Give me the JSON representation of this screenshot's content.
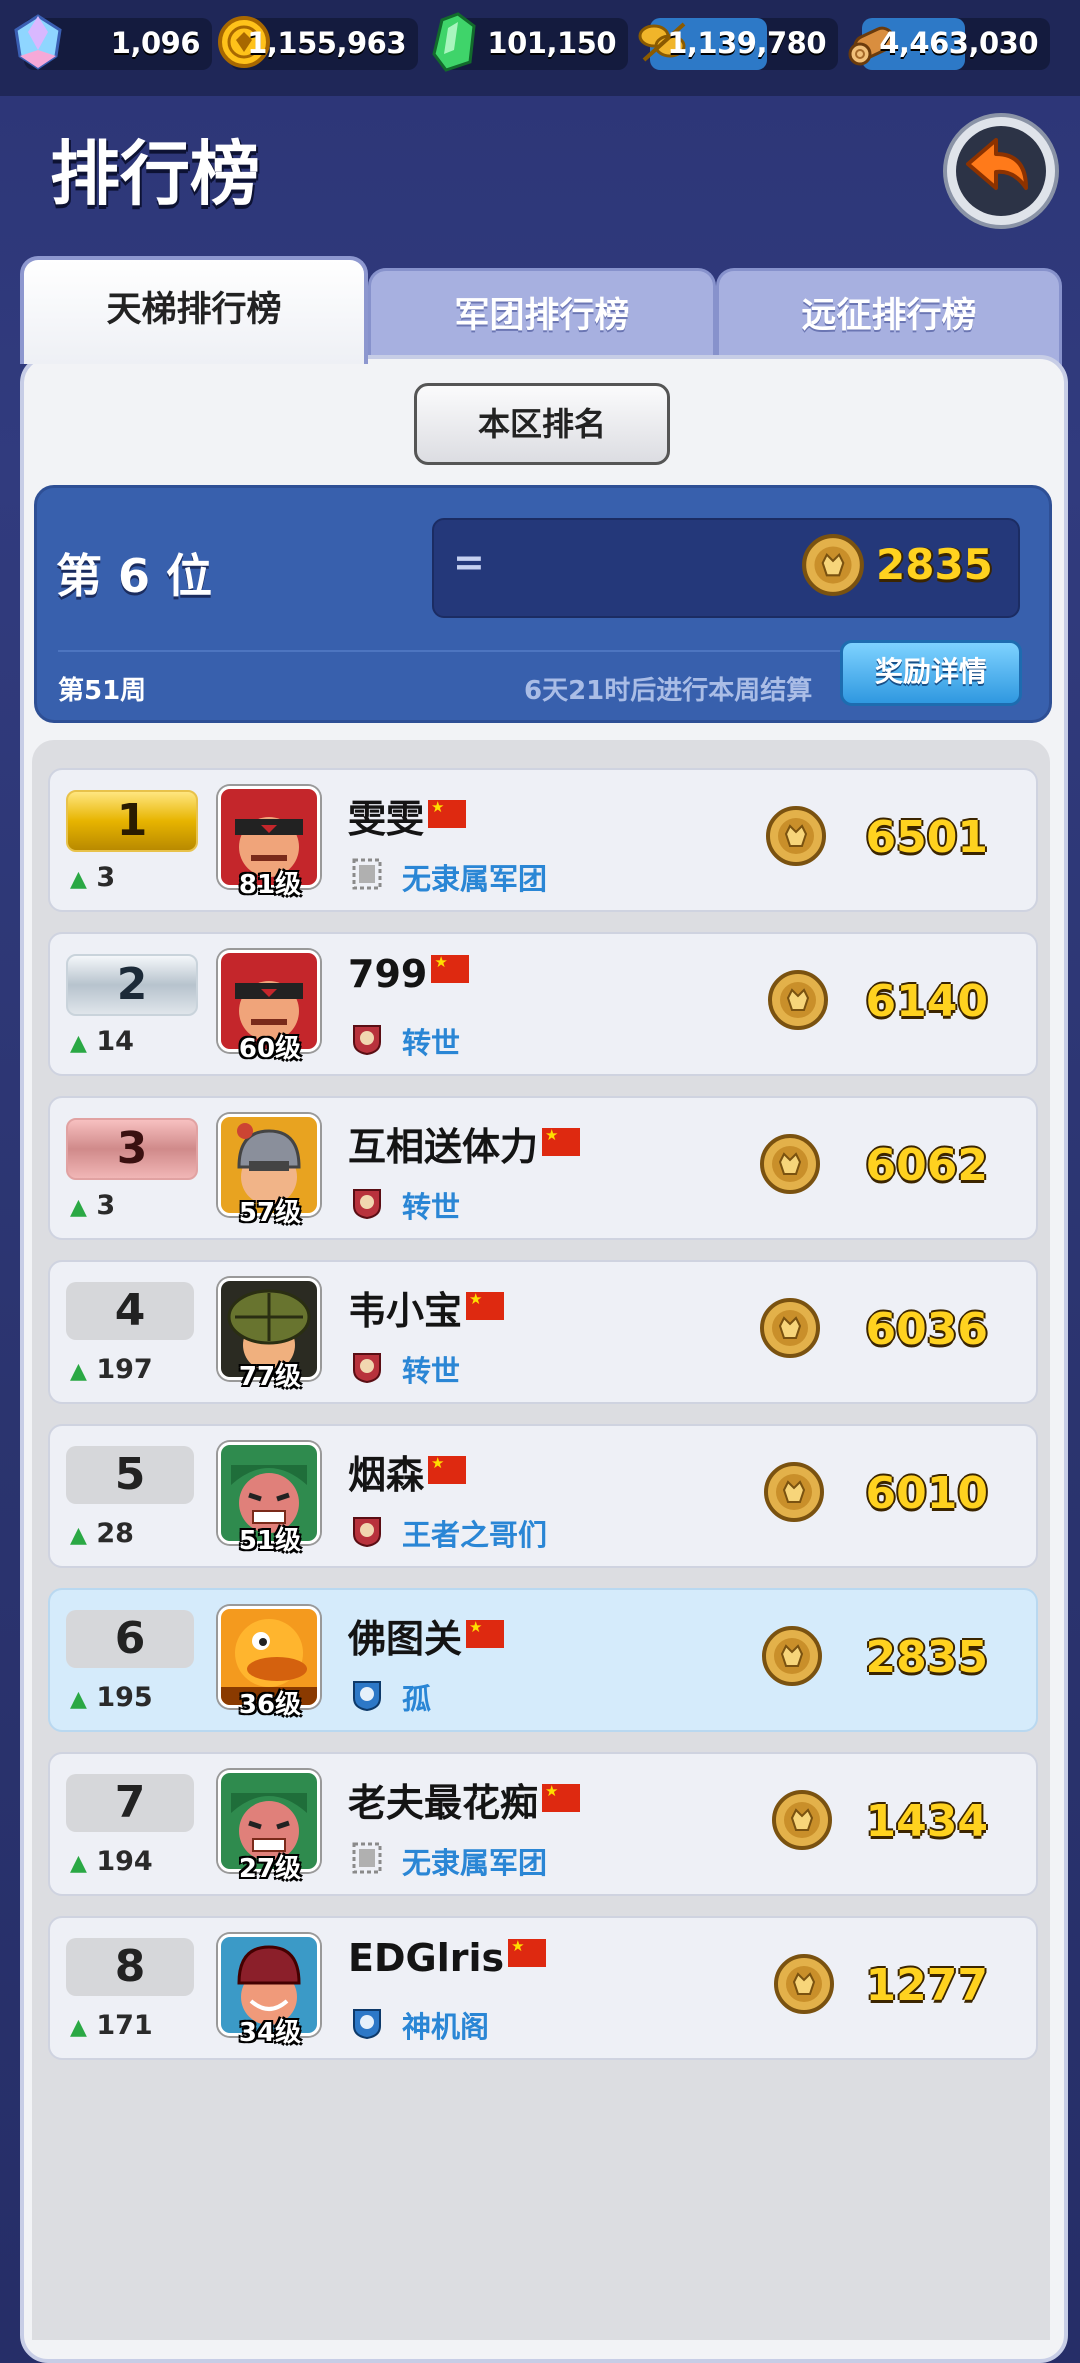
{
  "resources": [
    {
      "name": "gem",
      "value": "1,096"
    },
    {
      "name": "gold-coin",
      "value": "1,155,963"
    },
    {
      "name": "green-crystal",
      "value": "101,150"
    },
    {
      "name": "grain",
      "value": "1,139,780"
    },
    {
      "name": "wood",
      "value": "4,463,030"
    }
  ],
  "header": {
    "title": "排行榜",
    "back_icon": "back-arrow-icon"
  },
  "tabs": [
    {
      "label": "天梯排行榜",
      "active": true
    },
    {
      "label": "军团排行榜",
      "active": false
    },
    {
      "label": "远征排行榜",
      "active": false
    }
  ],
  "region_button": "本区排名",
  "my_rank": {
    "label": "第 6 位",
    "trend": "=",
    "score": "2835",
    "week": "第51周",
    "settle_text": "6天21时后进行本周结算",
    "reward_button": "奖励详情"
  },
  "rows": [
    {
      "rank": "1",
      "trend": "3",
      "level": "81级",
      "name": "雯雯",
      "guild": "无隶属军团",
      "score": "6501",
      "avatar": "bandana-red"
    },
    {
      "rank": "2",
      "trend": "14",
      "level": "60级",
      "name": "799",
      "guild": "转世",
      "score": "6140",
      "avatar": "bandana-red"
    },
    {
      "rank": "3",
      "trend": "3",
      "level": "57级",
      "name": "互相送体力",
      "guild": "转世",
      "score": "6062",
      "avatar": "helmet-knight"
    },
    {
      "rank": "4",
      "trend": "197",
      "level": "77级",
      "name": "韦小宝",
      "guild": "转世",
      "score": "6036",
      "avatar": "hat-soldier"
    },
    {
      "rank": "5",
      "trend": "28",
      "level": "51级",
      "name": "烟森",
      "guild": "王者之哥们",
      "score": "6010",
      "avatar": "green-hood"
    },
    {
      "rank": "6",
      "trend": "195",
      "level": "36级",
      "name": "佛图关",
      "guild": "孤",
      "score": "2835",
      "avatar": "orange-duck"
    },
    {
      "rank": "7",
      "trend": "194",
      "level": "27级",
      "name": "老夫最花痴",
      "guild": "无隶属军团",
      "score": "1434",
      "avatar": "green-hood"
    },
    {
      "rank": "8",
      "trend": "171",
      "level": "34级",
      "name": "EDGlris",
      "guild": "神机阁",
      "score": "1277",
      "avatar": "red-helmet"
    }
  ],
  "colors": {
    "accent_blue": "#3860ad",
    "score_gold": "#ffd21f",
    "guild_blue": "#2a86d5",
    "trend_green": "#2aa844"
  }
}
